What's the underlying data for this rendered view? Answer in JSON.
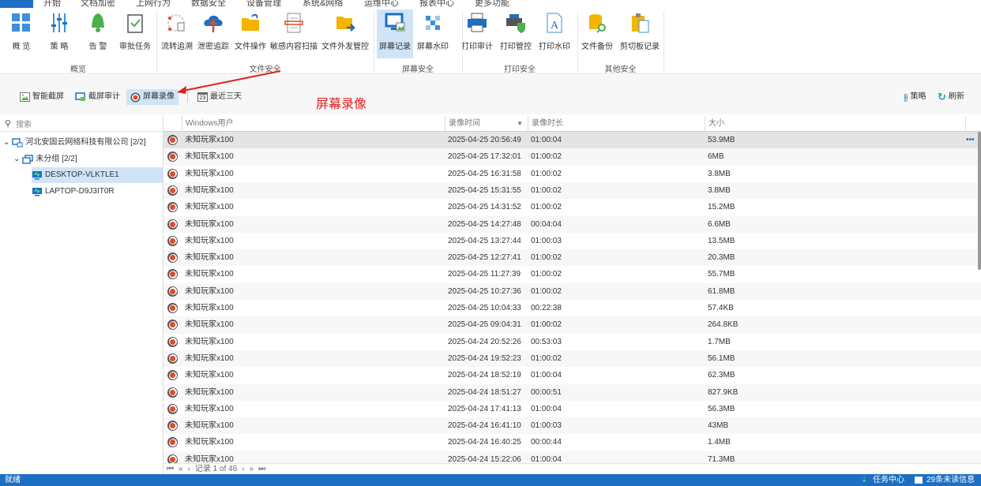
{
  "tabs": [
    "开始",
    "文档加密",
    "上网行为",
    "数据安全",
    "设备管理",
    "系统&网络",
    "运维中心",
    "报表中心",
    "更多功能"
  ],
  "active_tab": "数据安全",
  "ribbon": {
    "buttons": [
      "概 览",
      "策 略",
      "告 警",
      "审批任务",
      "流转追溯",
      "泄密追踪",
      "文件操作",
      "敏感内容扫描",
      "文件外发管控",
      "屏幕记录",
      "屏幕水印",
      "打印审计",
      "打印管控",
      "打印水印",
      "文件备份",
      "剪切板记录"
    ],
    "groups": [
      "概览",
      "文件安全",
      "屏幕安全",
      "打印安全",
      "其他安全"
    ],
    "selected": "屏幕记录"
  },
  "toolbar": {
    "smart_capture": "智能截屏",
    "capture_audit": "截屏审计",
    "screen_record": "屏幕录像",
    "date_range": "最近三天",
    "date_icon_day": "23",
    "policy": "策略",
    "refresh": "刷新"
  },
  "annotation": "屏幕录像",
  "sidebar": {
    "search_placeholder": "搜索",
    "tree": {
      "company": "河北安固云网络科技有限公司  [2/2]",
      "group": "未分组  [2/2]",
      "computers": [
        "DESKTOP-VLKTLE1",
        "LAPTOP-D9J3IT0R"
      ],
      "selected": "DESKTOP-VLKTLE1"
    }
  },
  "table": {
    "columns": [
      "Windows用户",
      "录像时间",
      "录像时长",
      "大小"
    ],
    "rows": [
      [
        "未知玩家x100",
        "2025-04-25 20:56:49",
        "01:00:04",
        "53.9MB"
      ],
      [
        "未知玩家x100",
        "2025-04-25 17:32:01",
        "01:00:02",
        "6MB"
      ],
      [
        "未知玩家x100",
        "2025-04-25 16:31:58",
        "01:00:02",
        "3.8MB"
      ],
      [
        "未知玩家x100",
        "2025-04-25 15:31:55",
        "01:00:02",
        "3.8MB"
      ],
      [
        "未知玩家x100",
        "2025-04-25 14:31:52",
        "01:00:02",
        "15.2MB"
      ],
      [
        "未知玩家x100",
        "2025-04-25 14:27:48",
        "00:04:04",
        "6.6MB"
      ],
      [
        "未知玩家x100",
        "2025-04-25 13:27:44",
        "01:00:03",
        "13.5MB"
      ],
      [
        "未知玩家x100",
        "2025-04-25 12:27:41",
        "01:00:02",
        "20.3MB"
      ],
      [
        "未知玩家x100",
        "2025-04-25 11:27:39",
        "01:00:02",
        "55.7MB"
      ],
      [
        "未知玩家x100",
        "2025-04-25 10:27:36",
        "01:00:02",
        "61.8MB"
      ],
      [
        "未知玩家x100",
        "2025-04-25 10:04:33",
        "00:22:38",
        "57.4KB"
      ],
      [
        "未知玩家x100",
        "2025-04-25 09:04:31",
        "01:00:02",
        "264.8KB"
      ],
      [
        "未知玩家x100",
        "2025-04-24 20:52:26",
        "00:53:03",
        "1.7MB"
      ],
      [
        "未知玩家x100",
        "2025-04-24 19:52:23",
        "01:00:02",
        "56.1MB"
      ],
      [
        "未知玩家x100",
        "2025-04-24 18:52:19",
        "01:00:04",
        "62.3MB"
      ],
      [
        "未知玩家x100",
        "2025-04-24 18:51:27",
        "00:00:51",
        "827.9KB"
      ],
      [
        "未知玩家x100",
        "2025-04-24 17:41:13",
        "01:00:04",
        "56.3MB"
      ],
      [
        "未知玩家x100",
        "2025-04-24 16:41:10",
        "01:00:03",
        "43MB"
      ],
      [
        "未知玩家x100",
        "2025-04-24 16:40:25",
        "00:00:44",
        "1.4MB"
      ],
      [
        "未知玩家x100",
        "2025-04-24 15:22:06",
        "01:00:04",
        "71.3MB"
      ]
    ],
    "row_more": "•••"
  },
  "pager": {
    "first": "⏮",
    "prev_page": "«",
    "prev": "‹",
    "text": "记录 1 of 46",
    "next": "›",
    "next_page": "»",
    "last": "⏭"
  },
  "status": {
    "left": "就绪",
    "task_center": "任务中心",
    "unread": "29条未读信息"
  },
  "colors": {
    "accent": "#1c6fc2",
    "annotation": "#e02020",
    "selected": "#cfe4f7"
  }
}
